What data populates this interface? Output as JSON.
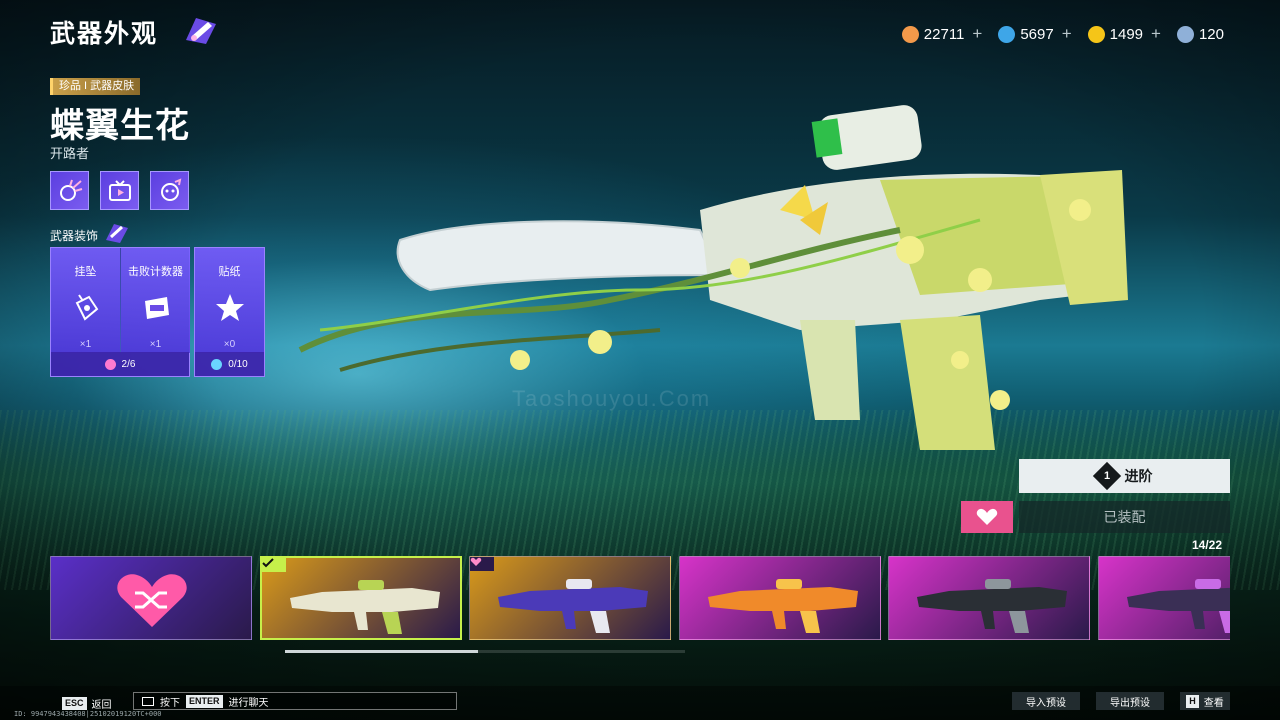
{
  "header": {
    "title": "武器外观",
    "title_icon": "paint-brush-icon",
    "currencies": [
      {
        "icon": "gear-coin-icon",
        "color": "#f2994a",
        "value": "22711",
        "addable": true
      },
      {
        "icon": "blue-token-icon",
        "color": "#3ea6e8",
        "value": "5697",
        "addable": true
      },
      {
        "icon": "lightning-coin-icon",
        "color": "#f5c518",
        "value": "1499",
        "addable": true
      },
      {
        "icon": "ticket-icon",
        "color": "#8fb0d8",
        "value": "120",
        "addable": false
      }
    ],
    "plus_label": "+"
  },
  "skin": {
    "rarity_tag": "珍品 I 武器皮肤",
    "name": "蝶翼生花",
    "weapon_type": "开路者",
    "features": [
      "burst-effect-icon",
      "tv-screen-icon",
      "face-badge-icon"
    ]
  },
  "decorations": {
    "title": "武器装饰",
    "slots": [
      {
        "label": "挂坠",
        "icon": "pendant-icon",
        "count": "×1"
      },
      {
        "label": "击败计数器",
        "icon": "counter-icon",
        "count": "×1"
      },
      {
        "label": "贴纸",
        "icon": "sticker-icon",
        "count": "×0"
      }
    ],
    "footer_left": "2/6",
    "footer_right": "0/10"
  },
  "actions": {
    "advance_number": "1",
    "advance_label": "进阶",
    "equipped_label": "已装配",
    "fav_icon": "heart-icon"
  },
  "gallery": {
    "count": "14/22",
    "cards": [
      {
        "kind": "random",
        "icon": "shuffle-heart-icon",
        "bg": "#5a2fc8",
        "selected": false
      },
      {
        "kind": "skin",
        "bg": "#d99a1a",
        "selected": true,
        "badge": "check-icon",
        "gun": "#e8e6d0",
        "accent": "#b8d454"
      },
      {
        "kind": "skin",
        "bg": "#d99a1a",
        "selected": false,
        "badge": "heart-icon",
        "gun": "#4b3ab8",
        "accent": "#e8e8f0"
      },
      {
        "kind": "skin",
        "bg": "#d733c9",
        "selected": false,
        "badge": "",
        "gun": "#f08a2a",
        "accent": "#f7c34b"
      },
      {
        "kind": "skin",
        "bg": "#d733c9",
        "selected": false,
        "badge": "",
        "gun": "#2a2f35",
        "accent": "#8d969c"
      },
      {
        "kind": "skin",
        "bg": "#d733c9",
        "selected": false,
        "badge": "",
        "gun": "#3a2f55",
        "accent": "#c96be6"
      }
    ]
  },
  "footer": {
    "esc_key": "ESC",
    "back_label": "返回",
    "chat_press": "按下",
    "enter_key": "ENTER",
    "chat_label": "进行聊天",
    "import_label": "导入预设",
    "export_label": "导出预设",
    "h_key": "H",
    "view_label": "查看",
    "uid": "ID: 9947943438408|25102019120TC+000"
  },
  "watermark": "Taoshouyou.Com"
}
